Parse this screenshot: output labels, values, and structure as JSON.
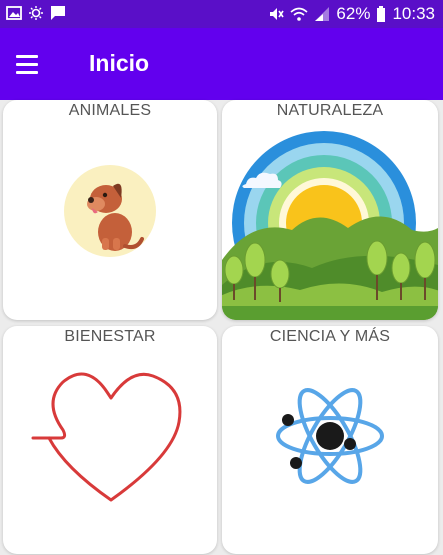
{
  "status_bar": {
    "battery": "62%",
    "time": "10:33"
  },
  "app_bar": {
    "title": "Inicio"
  },
  "categories": [
    {
      "label": "ANIMALES"
    },
    {
      "label": "NATURALEZA"
    },
    {
      "label": "BIENESTAR"
    },
    {
      "label": "CIENCIA Y MÁS"
    }
  ],
  "colors": {
    "status_bar": "#5a0fc8",
    "app_bar": "#6200ee"
  }
}
